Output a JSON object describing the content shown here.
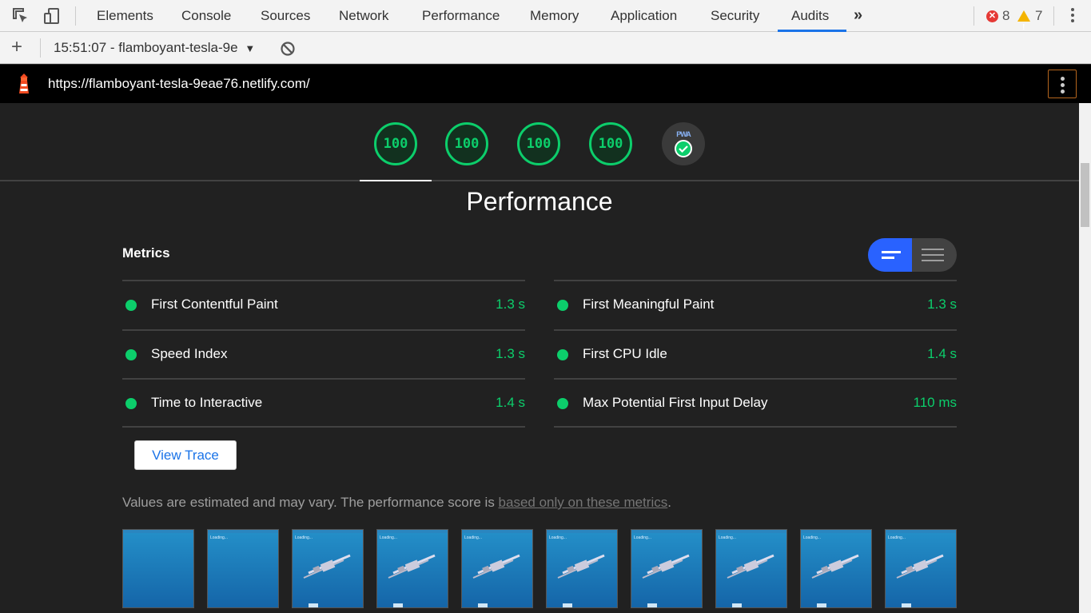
{
  "devtools": {
    "tabs": [
      "Elements",
      "Console",
      "Sources",
      "Network",
      "Performance",
      "Memory",
      "Application",
      "Security",
      "Audits"
    ],
    "active_tab": "Audits",
    "more_tabs_glyph": "»",
    "error_count": "8",
    "warning_count": "7"
  },
  "audits_toolbar": {
    "add_glyph": "+",
    "report_label": "15:51:07 - flamboyant-tesla-9e",
    "dropdown_glyph": "▼"
  },
  "report": {
    "url": "https://flamboyant-tesla-9eae76.netlify.com/",
    "scores": [
      "100",
      "100",
      "100",
      "100"
    ],
    "pwa_label": "PWA",
    "category_title": "Performance",
    "metrics_title": "Metrics",
    "metrics_left": [
      {
        "name": "First Contentful Paint",
        "value": "1.3 s"
      },
      {
        "name": "Speed Index",
        "value": "1.3 s"
      },
      {
        "name": "Time to Interactive",
        "value": "1.4 s"
      }
    ],
    "metrics_right": [
      {
        "name": "First Meaningful Paint",
        "value": "1.3 s"
      },
      {
        "name": "First CPU Idle",
        "value": "1.4 s"
      },
      {
        "name": "Max Potential First Input Delay",
        "value": "110 ms"
      }
    ],
    "view_trace_label": "View Trace",
    "note_prefix": "Values are estimated and may vary. The performance score is ",
    "note_link": "based only on these metrics",
    "note_suffix": ".",
    "filmstrip_frames": 10,
    "filmstrip_loading_text": "Loading..."
  },
  "colors": {
    "pass": "#0cce6b",
    "accent": "#1a73e8",
    "background": "#212121"
  }
}
